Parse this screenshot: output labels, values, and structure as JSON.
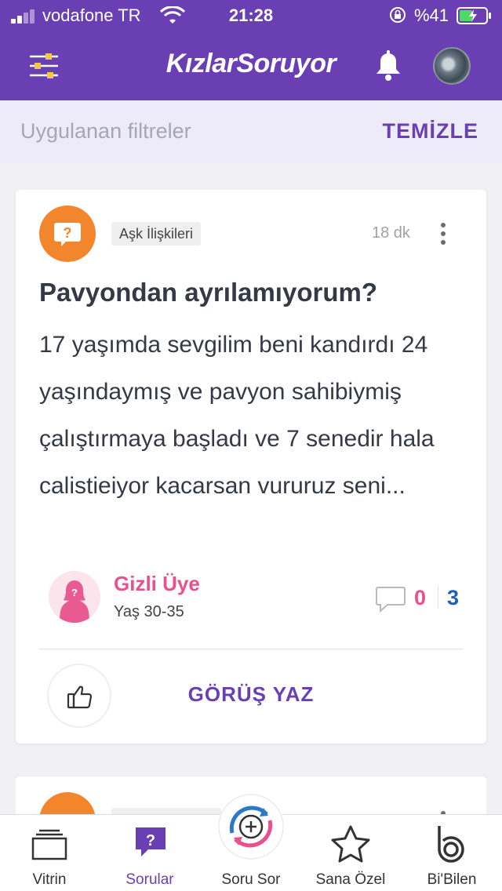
{
  "status_bar": {
    "carrier": "vodafone TR",
    "time": "21:28",
    "battery": "%41"
  },
  "app_bar": {
    "logo": "KızlarSoruyor"
  },
  "filter_bar": {
    "label": "Uygulanan filtreler",
    "clear": "TEMİZLE"
  },
  "question": {
    "category": "Aşk İlişkileri",
    "time": "18 dk",
    "title": "Pavyondan ayrılamıyorum?",
    "body": "17 yaşımda sevgilim beni kandırdı 24 yaşındaymış ve pavyon sahibiymiş çalıştırmaya başladı ve 7 senedir hala calistieiyor kacarsan vururuz seni...",
    "author_name": "Gizli Üye",
    "author_age": "Yaş 30-35",
    "count_a": "0",
    "count_b": "3",
    "opinion_button": "GÖRÜŞ YAZ"
  },
  "tabs": [
    {
      "label": "Vitrin",
      "icon": "showcase-icon"
    },
    {
      "label": "Sorular",
      "icon": "question-icon",
      "active": true
    },
    {
      "label": "Soru Sor",
      "icon": "plus-icon"
    },
    {
      "label": "Sana Özel",
      "icon": "star-icon"
    },
    {
      "label": "Bi'Bilen",
      "icon": "bibilen-icon"
    }
  ],
  "colors": {
    "brand": "#6a3fb3",
    "category": "#f3852d",
    "pink": "#e8508f",
    "blue": "#1f5fb3"
  }
}
